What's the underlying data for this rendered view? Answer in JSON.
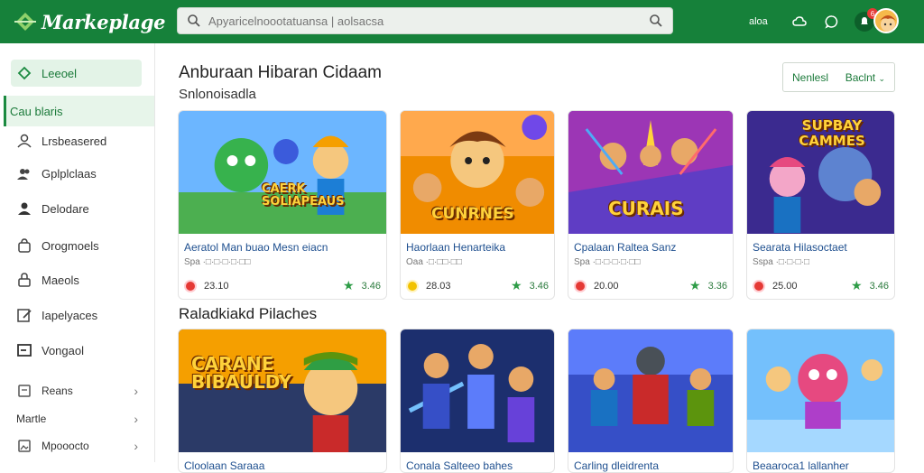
{
  "app": {
    "name": "Markeplage"
  },
  "search": {
    "placeholder": "Apyaricelnoootatuansa | aolsacsa"
  },
  "top_actions": {
    "label": "aloa"
  },
  "notifications": {
    "badge": "6"
  },
  "sidebar": {
    "items": [
      {
        "label": "Leeoel",
        "icon": "tag-icon"
      },
      {
        "label": "Cau blaris",
        "icon": "none"
      },
      {
        "label": "Lrsbeasered",
        "icon": "user-outline-icon"
      },
      {
        "label": "Gplplclaas",
        "icon": "users-icon"
      },
      {
        "label": "Delodare",
        "icon": "person-icon"
      },
      {
        "label": "Orogmoels",
        "icon": "bag-icon"
      },
      {
        "label": "Maeols",
        "icon": "lock-icon"
      },
      {
        "label": "Iapelyaces",
        "icon": "edit-icon"
      },
      {
        "label": "Vongaol",
        "icon": "box-icon"
      },
      {
        "label": "Reans",
        "icon": "doc-icon"
      },
      {
        "label": "Martle",
        "icon": "none"
      },
      {
        "label": "Mpooocto",
        "icon": "image-icon"
      }
    ]
  },
  "main": {
    "section1_title": "Anburaan Hibaran Cidaam",
    "section1_sub": "Snlonoisadla",
    "filter": {
      "label1": "Nenlesl",
      "label2": "Baclnt"
    },
    "section2_title": "Raladkiakd Pilaches"
  },
  "cards_row1": [
    {
      "title": "Aeratol Man buao Mesn eiacn",
      "meta": "Spa ·□·□·□·□·□□",
      "price": "23.10",
      "rating": "3.46",
      "price_color": "#e53935",
      "art_text": "CAERK SOLIAPEAUS"
    },
    {
      "title": "Haorlaan Henarteika",
      "meta": "Oaa ·□·□□·□□",
      "price": "28.03",
      "rating": "3.46",
      "price_color": "#f2c200",
      "art_text": "CUNRNES"
    },
    {
      "title": "Cpalaan Raltea Sanz",
      "meta": "Spa ·□·□·□·□·□□",
      "price": "20.00",
      "rating": "3.36",
      "price_color": "#e53935",
      "art_text": "CURAIS"
    },
    {
      "title": "Searata Hilasoctaet",
      "meta": "Sspa ·□·□·□·□",
      "price": "25.00",
      "rating": "3.46",
      "price_color": "#e53935",
      "art_text": "SUPBAY CAMMES"
    }
  ],
  "cards_row2": [
    {
      "title": "Cloolaan Saraaa",
      "art_text": "CARANE BIBAULDY"
    },
    {
      "title": "Conala Salteeo bahes",
      "art_text": ""
    },
    {
      "title": "Carling dleidrenta",
      "art_text": ""
    },
    {
      "title": "Beaaroca1 lallanher",
      "art_text": ""
    }
  ],
  "colors": {
    "brand": "#16813a",
    "accent": "#1b7a3a",
    "link": "#1e4f8f"
  }
}
